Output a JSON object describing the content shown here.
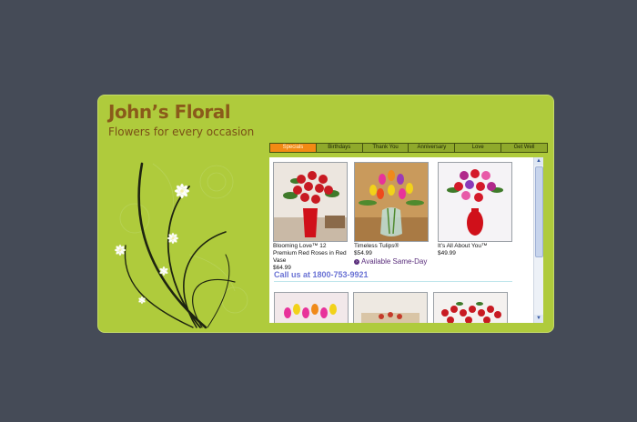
{
  "brand": {
    "title": "John’s Floral",
    "tagline": "Flowers for every occasion"
  },
  "tabs": [
    {
      "label": "Specials",
      "active": true
    },
    {
      "label": "Birthdays",
      "active": false
    },
    {
      "label": "Thank You",
      "active": false
    },
    {
      "label": "Anniversary",
      "active": false
    },
    {
      "label": "Love",
      "active": false
    },
    {
      "label": "Get Well",
      "active": false
    }
  ],
  "products": [
    {
      "name": "Blooming Love™ 12 Premium Red Roses in Red Vase",
      "price": "$64.99"
    },
    {
      "name": "Timeless Tulips®",
      "price": "$54.99",
      "badge": "Available Same-Day"
    },
    {
      "name": "It’s All About You™",
      "price": "$49.99"
    }
  ],
  "call": "Call us at 1800-753-9921",
  "colors": {
    "page_bg": "#454b57",
    "card_bg": "#afcb3c",
    "accent_tab": "#f28a14",
    "title": "#8a5a1a",
    "call_link": "#6a72d4"
  },
  "icons": {
    "same_day": "arrow-circle-icon",
    "scroll_up": "chevron-up-icon",
    "scroll_down": "chevron-down-icon"
  }
}
